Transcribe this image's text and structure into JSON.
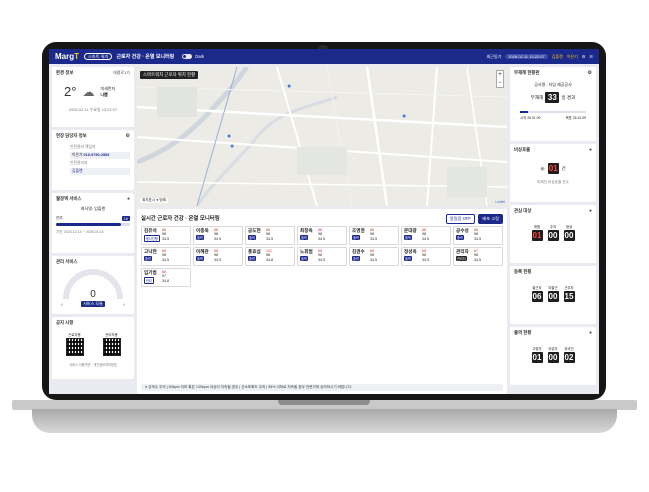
{
  "app": {
    "logo": "Marg",
    "logo_mark": "T",
    "tag": "스마트 워치",
    "title": "근로자 건강 · 온열 모니터링",
    "dark_label": "Dark",
    "sync_label": "최근동기",
    "sync_time": "2026.02.11 13:22:07",
    "user": "김플랜",
    "user2": "이은기"
  },
  "weather": {
    "title": "환경 정보",
    "location": "태평로1가",
    "temperature": "2°",
    "dust_label": "미세먼지",
    "dust_value": "나쁨",
    "datetime": "2026.02.11 수요일 13:22:07"
  },
  "manager": {
    "title": "현장 담당자 정보",
    "role1": "안전관리 책임자",
    "name1": "이은기",
    "phone1": "010-9790-2553",
    "role2": "안전관리자",
    "name2": "김플랜"
  },
  "monthly": {
    "title": "월정액 서비스",
    "company": "회사명: 입플랜",
    "remaining_label": "잔여",
    "count": "16",
    "period": "기간 2025.12.14 ~ 2026.01.14"
  },
  "paid": {
    "title": "관리 서비스",
    "value": "0",
    "label": "서비스 모듈",
    "min": "0",
    "max": "0"
  },
  "notice": {
    "title": "공지 사항",
    "qr1": "근로자용",
    "qr2": "관리자용",
    "footer": "서비스 이용약관 · 개인정보처리방침"
  },
  "map": {
    "label": "스마트워치 근로자 위치 현황",
    "legend": "위치표시 ● 범례",
    "attribution": "Leaflet"
  },
  "monitor": {
    "title": "실시간 근로자 건강 · 온열 모니터링",
    "btn_alarm": "알림음 OFF",
    "btn_fixed": "배포 고정",
    "legend": "● 심박수 주의 | 50bpm 이하 혹은 130bpm 이상이 지속될 경우 | 산소포화도 주의 | 95% 이하로 지속될 경우 전문가와 상의하시기 바랍니다."
  },
  "workers": [
    {
      "name": "김유석",
      "badge": "음사진행",
      "hr": "68",
      "o2": "98",
      "t": "34.5",
      "style": "out"
    },
    {
      "name": "이종욱",
      "badge": "출력",
      "hr": "68",
      "o2": "98",
      "t": "34.9",
      "style": ""
    },
    {
      "name": "공도현",
      "badge": "출력",
      "hr": "68",
      "o2": "98",
      "t": "34.5",
      "style": ""
    },
    {
      "name": "최창옥",
      "badge": "출력",
      "hr": "68",
      "o2": "98",
      "t": "34.5",
      "style": ""
    },
    {
      "name": "조명권",
      "badge": "출력",
      "hr": "68",
      "o2": "98",
      "t": "34.5",
      "style": ""
    },
    {
      "name": "문대광",
      "badge": "출력",
      "hr": "68",
      "o2": "98",
      "t": "34.5",
      "style": ""
    },
    {
      "name": "공수성",
      "badge": "출력",
      "hr": "68",
      "o2": "98",
      "t": "34.5",
      "style": ""
    },
    {
      "name": "고낙현",
      "badge": "출력",
      "hr": "68",
      "o2": "98",
      "t": "34.5",
      "style": ""
    },
    {
      "name": "이혜관",
      "badge": "출력",
      "hr": "58",
      "o2": "98",
      "t": "34.5",
      "style": ""
    },
    {
      "name": "홍효섭",
      "badge": "출력",
      "hr": "121",
      "o2": "98",
      "t": "34.8",
      "style": ""
    },
    {
      "name": "노휘범",
      "badge": "출력",
      "hr": "68",
      "o2": "98",
      "t": "34.5",
      "style": ""
    },
    {
      "name": "김권수",
      "badge": "출력",
      "hr": "68",
      "o2": "98",
      "t": "34.5",
      "style": ""
    },
    {
      "name": "정성옥",
      "badge": "출력",
      "hr": "68",
      "o2": "98",
      "t": "34.5",
      "style": ""
    },
    {
      "name": "관리자",
      "badge": "관리자",
      "hr": "87",
      "o2": "98",
      "t": "34.5",
      "style": "dark"
    },
    {
      "name": "입기범",
      "badge": "관리",
      "hr": "68",
      "o2": "97",
      "t": "34.8",
      "style": "out"
    }
  ],
  "accident": {
    "title": "무재해 현황판",
    "company": "공사명 : 타임 재공공사",
    "label_pre": "무재해",
    "days": "33",
    "label_post": "일 경과",
    "start_label": "시작",
    "start_date": "26.01.09",
    "target_label": "목표",
    "target_date": "26.10.09"
  },
  "emergency": {
    "title": "비상호출",
    "count": "01",
    "unit": "건",
    "note": "미해진 비상호출 건수"
  },
  "caution": {
    "title": "관심 대상",
    "labels": [
      "위험",
      "주의",
      "정상"
    ],
    "values": [
      "01",
      "00",
      "00"
    ]
  },
  "attendance": {
    "title": "등록 현황",
    "labels": [
      "출근자",
      "미출근",
      "근무자"
    ],
    "values": [
      "06",
      "00",
      "15"
    ]
  },
  "exit": {
    "title": "출역 현황",
    "labels": [
      "고령자",
      "여성자",
      "외국인"
    ],
    "values": [
      "01",
      "00",
      "02"
    ]
  }
}
